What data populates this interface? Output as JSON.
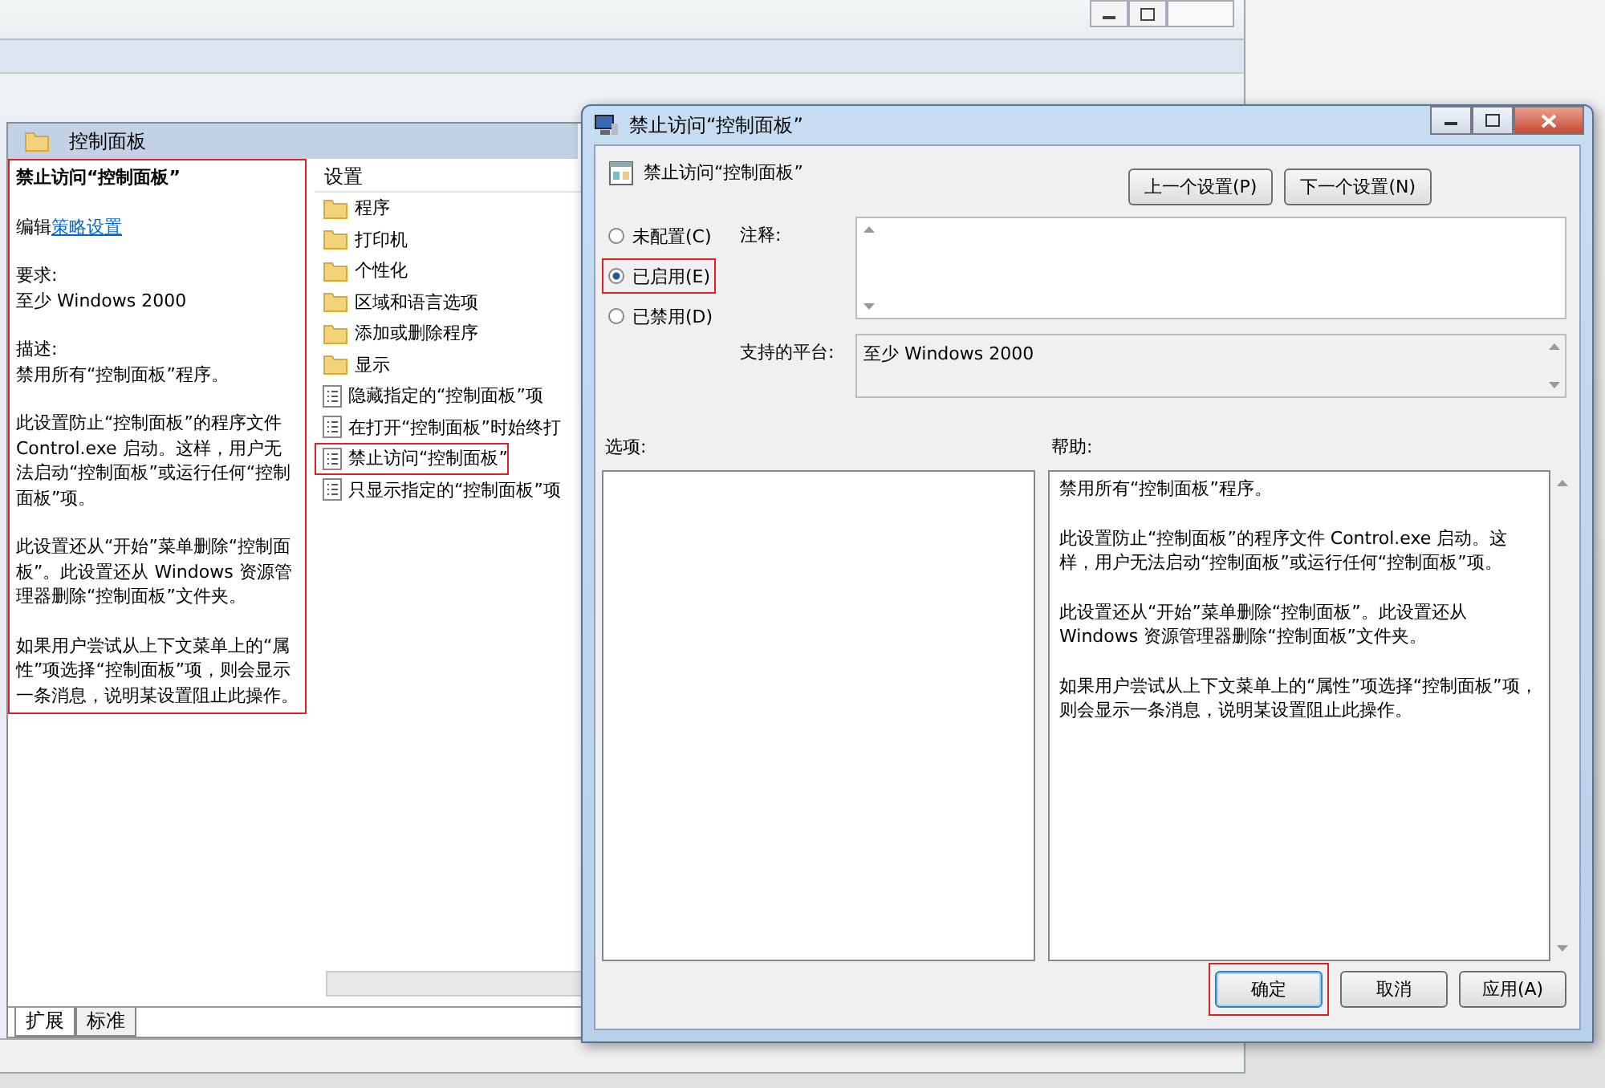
{
  "left_pane": {
    "header": "控制面板",
    "description": {
      "highlighted": true,
      "title": "禁止访问“控制面板”",
      "edit_prefix": "编辑",
      "edit_link": "策略设置",
      "requirement_label": "要求:",
      "requirement": "至少 Windows 2000",
      "description_label": "描述:",
      "paragraphs": [
        "禁用所有“控制面板”程序。",
        "此设置防止“控制面板”的程序文件 Control.exe 启动。这样，用户无法启动“控制面板”或运行任何“控制面板”项。",
        "此设置还从“开始”菜单删除“控制面板”。此设置还从 Windows 资源管理器删除“控制面板”文件夹。",
        "如果用户尝试从上下文菜单上的“属性”项选择“控制面板”项，则会显示一条消息，说明某设置阻止此操作。"
      ]
    },
    "settings_list": {
      "column": "设置",
      "items": [
        {
          "kind": "folder",
          "label": "程序",
          "highlighted": false
        },
        {
          "kind": "folder",
          "label": "打印机",
          "highlighted": false
        },
        {
          "kind": "folder",
          "label": "个性化",
          "highlighted": false
        },
        {
          "kind": "folder",
          "label": "区域和语言选项",
          "highlighted": false
        },
        {
          "kind": "folder",
          "label": "添加或删除程序",
          "highlighted": false
        },
        {
          "kind": "folder",
          "label": "显示",
          "highlighted": false
        },
        {
          "kind": "setting",
          "label": "隐藏指定的“控制面板”项",
          "highlighted": false
        },
        {
          "kind": "setting",
          "label": "在打开“控制面板”时始终打",
          "highlighted": false
        },
        {
          "kind": "setting",
          "label": "禁止访问“控制面板”",
          "highlighted": true
        },
        {
          "kind": "setting",
          "label": "只显示指定的“控制面板”项",
          "highlighted": false
        }
      ]
    },
    "view_tabs": [
      {
        "label": "扩展",
        "selected": true
      },
      {
        "label": "标准",
        "selected": false
      }
    ]
  },
  "dialog": {
    "title": "禁止访问“控制面板”",
    "header": "禁止访问“控制面板”",
    "nav_buttons": [
      "上一个设置(P)",
      "下一个设置(N)"
    ],
    "state_options": [
      {
        "label": "未配置(C)",
        "selected": false,
        "highlighted": false
      },
      {
        "label": "已启用(E)",
        "selected": true,
        "highlighted": true
      },
      {
        "label": "已禁用(D)",
        "selected": false,
        "highlighted": false
      }
    ],
    "comment_label": "注释:",
    "platform_label": "支持的平台:",
    "platform": "至少 Windows 2000",
    "options_label": "选项:",
    "help_label": "帮助:",
    "help_paragraphs": [
      "禁用所有“控制面板”程序。",
      "此设置防止“控制面板”的程序文件 Control.exe 启动。这样，用户无法启动“控制面板”或运行任何“控制面板”项。",
      "此设置还从“开始”菜单删除“控制面板”。此设置还从 Windows 资源管理器删除“控制面板”文件夹。",
      "如果用户尝试从上下文菜单上的“属性”项选择“控制面板”项，则会显示一条消息，说明某设置阻止此操作。"
    ],
    "footer_buttons": [
      {
        "label": "确定",
        "highlighted": true
      },
      {
        "label": "取消",
        "highlighted": false
      },
      {
        "label": "应用(A)",
        "highlighted": false
      }
    ]
  }
}
